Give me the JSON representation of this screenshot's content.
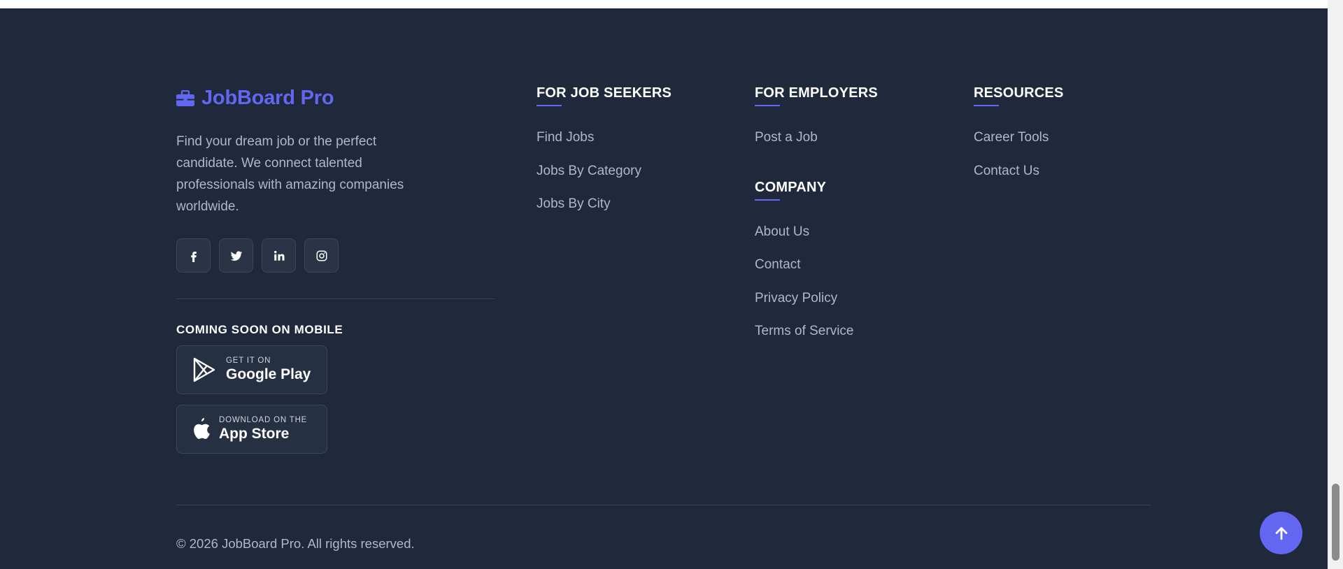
{
  "brand": {
    "name": "JobBoard Pro",
    "icon": "briefcase-icon",
    "color": "#6366f1"
  },
  "about": {
    "text": "Find your dream job or the perfect candidate. We connect talented professionals with amazing companies worldwide."
  },
  "socials": [
    {
      "name": "facebook",
      "icon": "facebook-icon"
    },
    {
      "name": "twitter",
      "icon": "twitter-icon"
    },
    {
      "name": "linkedin",
      "icon": "linkedin-icon"
    },
    {
      "name": "instagram",
      "icon": "instagram-icon"
    }
  ],
  "mobile": {
    "heading": "COMING SOON ON MOBILE",
    "google_play": {
      "small": "GET IT ON",
      "big": "Google Play",
      "icon": "google-play-icon"
    },
    "app_store": {
      "small": "DOWNLOAD ON THE",
      "big": "App Store",
      "icon": "apple-icon"
    }
  },
  "columns": {
    "job_seekers": {
      "heading": "FOR JOB SEEKERS",
      "links": [
        "Find Jobs",
        "Jobs By Category",
        "Jobs By City"
      ]
    },
    "employers": {
      "heading": "FOR EMPLOYERS",
      "links": [
        "Post a Job"
      ]
    },
    "company": {
      "heading": "COMPANY",
      "links": [
        "About Us",
        "Contact",
        "Privacy Policy",
        "Terms of Service"
      ]
    },
    "resources": {
      "heading": "RESOURCES",
      "links": [
        "Career Tools",
        "Contact Us"
      ]
    }
  },
  "copyright": "© 2026 JobBoard Pro. All rights reserved.",
  "back_to_top": {
    "icon": "arrow-up-icon"
  },
  "colors": {
    "background": "#1f293b",
    "accent": "#6366f1",
    "muted_text": "#aeb8c8"
  }
}
